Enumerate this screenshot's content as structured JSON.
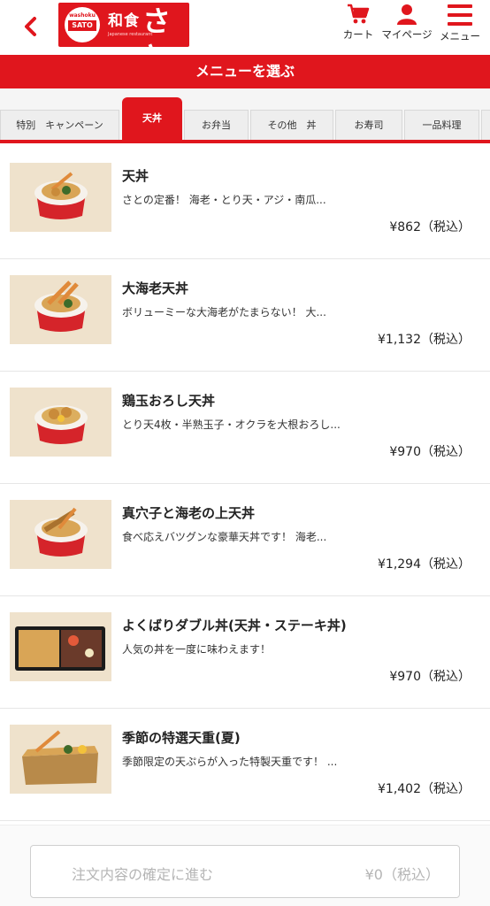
{
  "header": {
    "logo": {
      "brand_small": "washoku",
      "brand_sato": "SATO",
      "brand_wa": "和食",
      "brand_sato_jp": "さと",
      "brand_sub": "Japanese restaurant"
    },
    "cart_label": "カート",
    "mypage_label": "マイページ",
    "menu_label": "メニュー",
    "accent_color": "#e0161d"
  },
  "title_bar": {
    "title": "メニューを選ぶ"
  },
  "tabs": [
    {
      "label": "特別　キャンペーン",
      "active": false
    },
    {
      "label": "天丼",
      "active": true
    },
    {
      "label": "お弁当",
      "active": false
    },
    {
      "label": "その他　丼",
      "active": false
    },
    {
      "label": "お寿司",
      "active": false
    },
    {
      "label": "一品料理",
      "active": false
    }
  ],
  "items": [
    {
      "name": "天丼",
      "desc": "さとの定番！ 海老・とり天・アジ・南瓜...",
      "price": "¥862（税込）"
    },
    {
      "name": "大海老天丼",
      "desc": "ボリューミーな大海老がたまらない！ 大...",
      "price": "¥1,132（税込）"
    },
    {
      "name": "鶏玉おろし天丼",
      "desc": "とり天4枚・半熟玉子・オクラを大根おろし...",
      "price": "¥970（税込）"
    },
    {
      "name": "真穴子と海老の上天丼",
      "desc": "食べ応えバツグンな豪華天丼です！ 海老...",
      "price": "¥1,294（税込）"
    },
    {
      "name": "よくばりダブル丼(天丼・ステーキ丼)",
      "desc": "人気の丼を一度に味わえます！",
      "price": "¥970（税込）"
    },
    {
      "name": "季節の特選天重(夏)",
      "desc": "季節限定の天ぷらが入った特製天重です！ ...",
      "price": "¥1,402（税込）"
    }
  ],
  "order_bar": {
    "button_label": "注文内容の確定に進む",
    "total": "¥0（税込）"
  }
}
